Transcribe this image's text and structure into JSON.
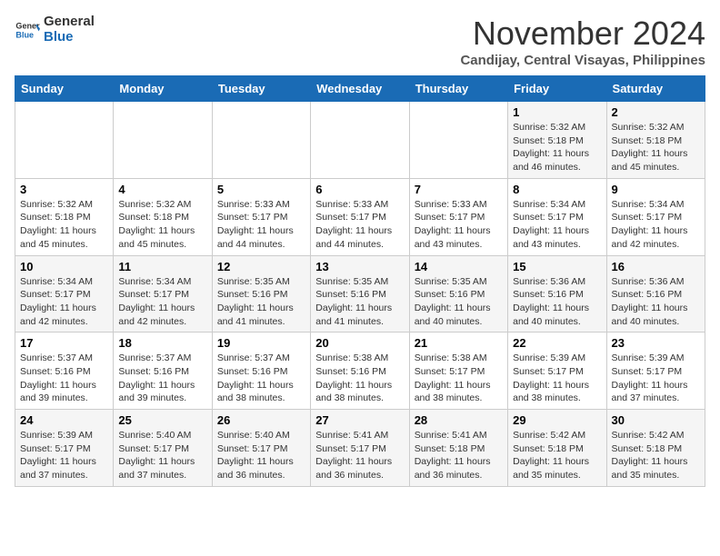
{
  "header": {
    "logo_line1": "General",
    "logo_line2": "Blue",
    "month": "November 2024",
    "location": "Candijay, Central Visayas, Philippines"
  },
  "days_of_week": [
    "Sunday",
    "Monday",
    "Tuesday",
    "Wednesday",
    "Thursday",
    "Friday",
    "Saturday"
  ],
  "weeks": [
    [
      {
        "day": "",
        "info": ""
      },
      {
        "day": "",
        "info": ""
      },
      {
        "day": "",
        "info": ""
      },
      {
        "day": "",
        "info": ""
      },
      {
        "day": "",
        "info": ""
      },
      {
        "day": "1",
        "info": "Sunrise: 5:32 AM\nSunset: 5:18 PM\nDaylight: 11 hours\nand 46 minutes."
      },
      {
        "day": "2",
        "info": "Sunrise: 5:32 AM\nSunset: 5:18 PM\nDaylight: 11 hours\nand 45 minutes."
      }
    ],
    [
      {
        "day": "3",
        "info": "Sunrise: 5:32 AM\nSunset: 5:18 PM\nDaylight: 11 hours\nand 45 minutes."
      },
      {
        "day": "4",
        "info": "Sunrise: 5:32 AM\nSunset: 5:18 PM\nDaylight: 11 hours\nand 45 minutes."
      },
      {
        "day": "5",
        "info": "Sunrise: 5:33 AM\nSunset: 5:17 PM\nDaylight: 11 hours\nand 44 minutes."
      },
      {
        "day": "6",
        "info": "Sunrise: 5:33 AM\nSunset: 5:17 PM\nDaylight: 11 hours\nand 44 minutes."
      },
      {
        "day": "7",
        "info": "Sunrise: 5:33 AM\nSunset: 5:17 PM\nDaylight: 11 hours\nand 43 minutes."
      },
      {
        "day": "8",
        "info": "Sunrise: 5:34 AM\nSunset: 5:17 PM\nDaylight: 11 hours\nand 43 minutes."
      },
      {
        "day": "9",
        "info": "Sunrise: 5:34 AM\nSunset: 5:17 PM\nDaylight: 11 hours\nand 42 minutes."
      }
    ],
    [
      {
        "day": "10",
        "info": "Sunrise: 5:34 AM\nSunset: 5:17 PM\nDaylight: 11 hours\nand 42 minutes."
      },
      {
        "day": "11",
        "info": "Sunrise: 5:34 AM\nSunset: 5:17 PM\nDaylight: 11 hours\nand 42 minutes."
      },
      {
        "day": "12",
        "info": "Sunrise: 5:35 AM\nSunset: 5:16 PM\nDaylight: 11 hours\nand 41 minutes."
      },
      {
        "day": "13",
        "info": "Sunrise: 5:35 AM\nSunset: 5:16 PM\nDaylight: 11 hours\nand 41 minutes."
      },
      {
        "day": "14",
        "info": "Sunrise: 5:35 AM\nSunset: 5:16 PM\nDaylight: 11 hours\nand 40 minutes."
      },
      {
        "day": "15",
        "info": "Sunrise: 5:36 AM\nSunset: 5:16 PM\nDaylight: 11 hours\nand 40 minutes."
      },
      {
        "day": "16",
        "info": "Sunrise: 5:36 AM\nSunset: 5:16 PM\nDaylight: 11 hours\nand 40 minutes."
      }
    ],
    [
      {
        "day": "17",
        "info": "Sunrise: 5:37 AM\nSunset: 5:16 PM\nDaylight: 11 hours\nand 39 minutes."
      },
      {
        "day": "18",
        "info": "Sunrise: 5:37 AM\nSunset: 5:16 PM\nDaylight: 11 hours\nand 39 minutes."
      },
      {
        "day": "19",
        "info": "Sunrise: 5:37 AM\nSunset: 5:16 PM\nDaylight: 11 hours\nand 38 minutes."
      },
      {
        "day": "20",
        "info": "Sunrise: 5:38 AM\nSunset: 5:16 PM\nDaylight: 11 hours\nand 38 minutes."
      },
      {
        "day": "21",
        "info": "Sunrise: 5:38 AM\nSunset: 5:17 PM\nDaylight: 11 hours\nand 38 minutes."
      },
      {
        "day": "22",
        "info": "Sunrise: 5:39 AM\nSunset: 5:17 PM\nDaylight: 11 hours\nand 38 minutes."
      },
      {
        "day": "23",
        "info": "Sunrise: 5:39 AM\nSunset: 5:17 PM\nDaylight: 11 hours\nand 37 minutes."
      }
    ],
    [
      {
        "day": "24",
        "info": "Sunrise: 5:39 AM\nSunset: 5:17 PM\nDaylight: 11 hours\nand 37 minutes."
      },
      {
        "day": "25",
        "info": "Sunrise: 5:40 AM\nSunset: 5:17 PM\nDaylight: 11 hours\nand 37 minutes."
      },
      {
        "day": "26",
        "info": "Sunrise: 5:40 AM\nSunset: 5:17 PM\nDaylight: 11 hours\nand 36 minutes."
      },
      {
        "day": "27",
        "info": "Sunrise: 5:41 AM\nSunset: 5:17 PM\nDaylight: 11 hours\nand 36 minutes."
      },
      {
        "day": "28",
        "info": "Sunrise: 5:41 AM\nSunset: 5:18 PM\nDaylight: 11 hours\nand 36 minutes."
      },
      {
        "day": "29",
        "info": "Sunrise: 5:42 AM\nSunset: 5:18 PM\nDaylight: 11 hours\nand 35 minutes."
      },
      {
        "day": "30",
        "info": "Sunrise: 5:42 AM\nSunset: 5:18 PM\nDaylight: 11 hours\nand 35 minutes."
      }
    ]
  ]
}
